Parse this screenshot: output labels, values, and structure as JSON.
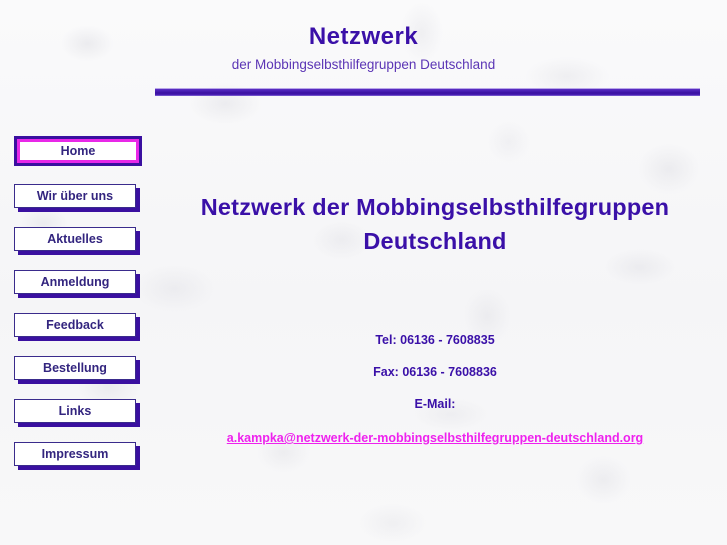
{
  "header": {
    "title": "Netzwerk",
    "subtitle": "der Mobbingselbsthilfegruppen Deutschland",
    "rule_color": "#3a10a0"
  },
  "sidebar": {
    "items": [
      {
        "label": "Home",
        "active": true
      },
      {
        "label": "Wir über uns",
        "active": false
      },
      {
        "label": "Aktuelles",
        "active": false
      },
      {
        "label": "Anmeldung",
        "active": false
      },
      {
        "label": "Feedback",
        "active": false
      },
      {
        "label": "Bestellung",
        "active": false
      },
      {
        "label": "Links",
        "active": false
      },
      {
        "label": "Impressum",
        "active": false
      }
    ],
    "active_border_color": "#e828e8",
    "border_color": "#3a2b8c",
    "shadow_color": "#3a10a0",
    "label_color": "#33257f"
  },
  "main": {
    "heading_line_1": "Netzwerk der Mobbingselbsthilfegruppen",
    "heading_line_2": "Deutschland",
    "heading_color": "#3a10a8"
  },
  "contact": {
    "tel": "Tel: 06136 - 7608835",
    "fax": "Fax: 06136 - 7608836",
    "email_label": "E-Mail:",
    "email_address": "a.kampka@netzwerk-der-mobbingselbsthilfegruppen-deutschland.org",
    "text_color": "#3a10a8",
    "link_color": "#ee22ee"
  }
}
